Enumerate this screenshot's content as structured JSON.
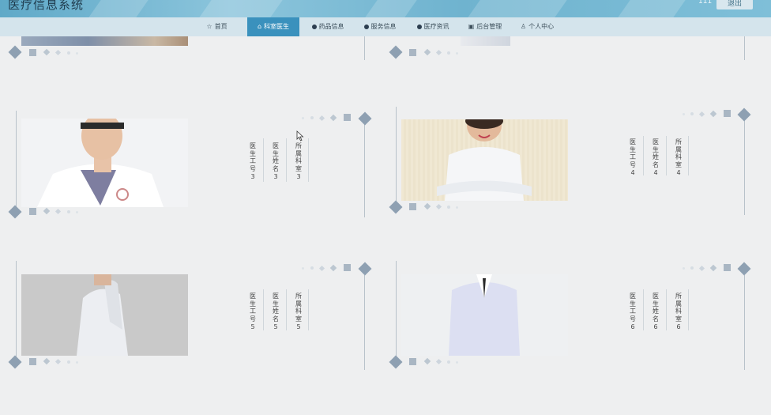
{
  "header": {
    "title": "医疗信息系统",
    "user": "111",
    "logout_label": "退出"
  },
  "nav": {
    "items": [
      {
        "label": "首页",
        "icon": "star-icon",
        "active": false
      },
      {
        "label": "科室医生",
        "icon": "bag-icon",
        "active": true
      },
      {
        "label": "药品信息",
        "icon": "dot-icon",
        "active": false
      },
      {
        "label": "服务信息",
        "icon": "question-icon",
        "active": false
      },
      {
        "label": "医疗资讯",
        "icon": "info-icon",
        "active": false
      },
      {
        "label": "后台管理",
        "icon": "briefcase-icon",
        "active": false
      },
      {
        "label": "个人中心",
        "icon": "user-icon",
        "active": false
      }
    ]
  },
  "doctors": [
    {
      "id_label": "医生工号",
      "id": "3",
      "name_label": "医生姓名",
      "name": "3",
      "dept_label": "所属科室",
      "dept": "3",
      "photo": "doctor-photo-3"
    },
    {
      "id_label": "医生工号",
      "id": "4",
      "name_label": "医生姓名",
      "name": "4",
      "dept_label": "所属科室",
      "dept": "4",
      "photo": "doctor-photo-4"
    },
    {
      "id_label": "医生工号",
      "id": "5",
      "name_label": "医生姓名",
      "name": "5",
      "dept_label": "所属科室",
      "dept": "5",
      "photo": "doctor-photo-5"
    },
    {
      "id_label": "医生工号",
      "id": "6",
      "name_label": "医生姓名",
      "name": "6",
      "dept_label": "所属科室",
      "dept": "6",
      "photo": "doctor-photo-6"
    }
  ],
  "colors": {
    "nav_active": "#3a91bd",
    "banner": "#6fb3cf",
    "background": "#eeeff0"
  }
}
